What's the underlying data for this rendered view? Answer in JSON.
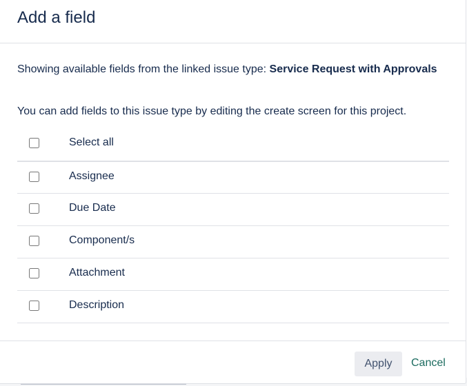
{
  "dialog": {
    "title": "Add a field"
  },
  "info": {
    "prefix": "Showing available fields from the linked issue type: ",
    "issue_type": "Service Request with Approvals",
    "help": "You can add fields to this issue type by editing the create screen for this project."
  },
  "select_all": {
    "label": "Select all",
    "checked": false
  },
  "fields": [
    {
      "label": "Assignee",
      "checked": false
    },
    {
      "label": "Due Date",
      "checked": false
    },
    {
      "label": "Component/s",
      "checked": false
    },
    {
      "label": "Attachment",
      "checked": false
    },
    {
      "label": "Description",
      "checked": false
    }
  ],
  "footer": {
    "apply_label": "Apply",
    "cancel_label": "Cancel"
  },
  "colors": {
    "text": "#172b4d",
    "link": "#1b6b5f",
    "button_bg": "#ebecf0",
    "divider": "#dfe1e6"
  }
}
